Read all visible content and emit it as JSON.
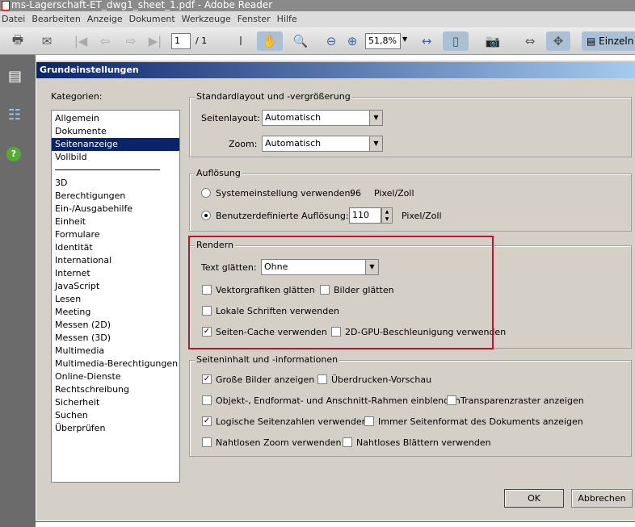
{
  "app": {
    "title": "ms-Lagerschaft-ET_dwg1_sheet_1.pdf - Adobe Reader",
    "menu": [
      "Datei",
      "Bearbeiten",
      "Anzeige",
      "Dokument",
      "Werkzeuge",
      "Fenster",
      "Hilfe"
    ],
    "toolbar": {
      "page": "1",
      "page_total": "/ 1",
      "zoom": "51,8%",
      "view_label": "Einzeln"
    }
  },
  "dialog": {
    "title": "Grundeinstellungen",
    "categories_label": "Kategorien:",
    "categories": [
      "Allgemein",
      "Dokumente",
      "Seitenanzeige",
      "Vollbild",
      "3D",
      "Berechtigungen",
      "Ein-/Ausgabehilfe",
      "Einheit",
      "Formulare",
      "Identität",
      "International",
      "Internet",
      "JavaScript",
      "Lesen",
      "Meeting",
      "Messen (2D)",
      "Messen (3D)",
      "Multimedia",
      "Multimedia-Berechtigungen",
      "Online-Dienste",
      "Rechtschreibung",
      "Sicherheit",
      "Suchen",
      "Überprüfen"
    ],
    "selected": "Seitenanzeige",
    "layout": {
      "title": "Standardlayout und -vergrößerung",
      "seitenlayout_label": "Seitenlayout:",
      "seitenlayout": "Automatisch",
      "zoom_label": "Zoom:",
      "zoom": "Automatisch"
    },
    "resolution": {
      "title": "Auflösung",
      "system_label": "Systemeinstellung verwenden:",
      "system_value": "96",
      "system_unit": "Pixel/Zoll",
      "custom_label": "Benutzerdefinierte Auflösung:",
      "custom_value": "110",
      "custom_unit": "Pixel/Zoll"
    },
    "render": {
      "title": "Rendern",
      "text_label": "Text glätten:",
      "text_value": "Ohne",
      "vektor": "Vektorgrafiken glätten",
      "bilder": "Bilder glätten",
      "lokale": "Lokale Schriften verwenden",
      "cache": "Seiten-Cache verwenden",
      "gpu": "2D-GPU-Beschleunigung verwenden"
    },
    "content": {
      "title": "Seiteninhalt und -informationen",
      "grosse": "Große Bilder anzeigen",
      "ueberdrucken": "Überdrucken-Vorschau",
      "objekt": "Objekt-, Endformat- und Anschnitt-Rahmen einblenden",
      "transparenz": "Transparenzraster anzeigen",
      "logische": "Logische Seitenzahlen verwenden",
      "immer": "Immer Seitenformat des Dokuments anzeigen",
      "nahtlos_zoom": "Nahtlosen Zoom verwenden",
      "nahtlos_blaettern": "Nahtloses Blättern verwenden"
    },
    "ok": "OK",
    "cancel": "Abbrechen"
  }
}
